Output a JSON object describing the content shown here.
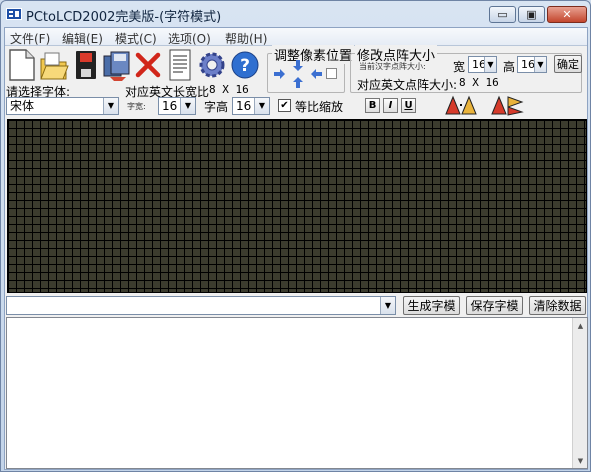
{
  "window": {
    "title": "PCtoLCD2002完美版-(字符模式)",
    "min_glyph": "▭",
    "max_glyph": "▣",
    "close_glyph": "✕"
  },
  "menu": [
    "文件(F)",
    "编辑(E)",
    "模式(C)",
    "选项(O)",
    "帮助(H)"
  ],
  "toolbar_icons": [
    "new-file-icon",
    "open-folder-icon",
    "save-disk-icon",
    "save-as-icon",
    "delete-icon",
    "document-icon",
    "settings-gear-icon",
    "help-icon"
  ],
  "font_select": {
    "label": "请选择字体:",
    "value": "宋体"
  },
  "en_ratio": {
    "label": "对应英文长宽比",
    "value": "8 X 16"
  },
  "width_field": {
    "label": "字宽:",
    "value": "16"
  },
  "height_field": {
    "label": "字高",
    "value": "16"
  },
  "proportional": {
    "label": "等比缩放",
    "checked": true
  },
  "format_buttons": [
    "B",
    "I",
    "U"
  ],
  "pixel_group": {
    "title": "调整像素位置"
  },
  "matrix_group": {
    "title": "修改点阵大小",
    "current_label": "当前汉字点阵大小:",
    "width_label": "宽",
    "width_value": "16",
    "height_label": "高",
    "height_value": "16",
    "confirm_label": "确定",
    "en_label": "对应英文点阵大小:",
    "en_value": "8 X 16"
  },
  "text_input": {
    "value": ""
  },
  "actions": {
    "generate": "生成字模",
    "save": "保存字模",
    "clear": "清除数据"
  },
  "output": {
    "text": ""
  },
  "colors": {
    "grid_cell": "#3c3c2e",
    "grid_line": "#000000",
    "close_button": "#c3462d"
  }
}
